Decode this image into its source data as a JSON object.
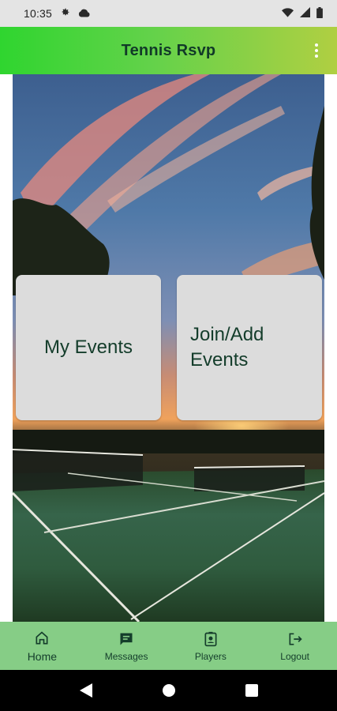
{
  "status_bar": {
    "time": "10:35",
    "left_icons": [
      "settings-icon",
      "cloud-icon"
    ],
    "right_icons": [
      "wifi-icon",
      "signal-icon",
      "battery-icon"
    ]
  },
  "app_bar": {
    "title": "Tennis Rsvp",
    "overflow_icon": "more-vert-icon"
  },
  "cards": [
    {
      "label": "My Events"
    },
    {
      "label": "Join/Add\nEvents"
    }
  ],
  "bottom_nav": {
    "selected": "Home",
    "items": [
      {
        "label": "Home",
        "icon": "home-icon"
      },
      {
        "label": "Messages",
        "icon": "message-icon"
      },
      {
        "label": "Players",
        "icon": "contact-badge-icon"
      },
      {
        "label": "Logout",
        "icon": "logout-icon"
      }
    ]
  },
  "system_nav": [
    "back-icon",
    "home-circle-icon",
    "recents-icon"
  ],
  "colors": {
    "app_bar_gradient_start": "#2fd52f",
    "app_bar_gradient_end": "#b0cf42",
    "title_text": "#113a28",
    "card_background": "#dcdcdc",
    "bottom_nav_background": "#86cd86"
  }
}
